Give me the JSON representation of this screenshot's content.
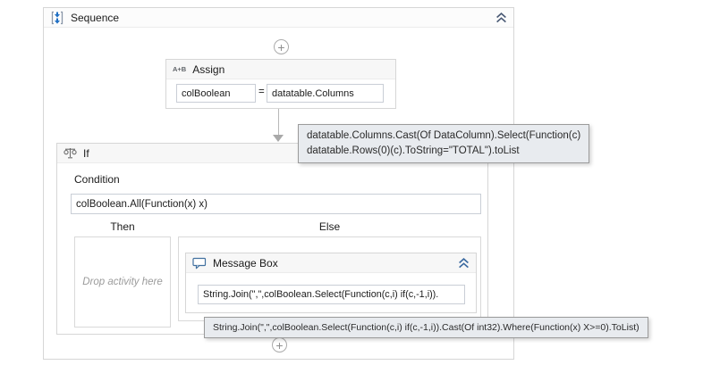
{
  "colors": {
    "accent_blue": "#1f6fc4",
    "activity_border": "#d6d6d6",
    "header_background": "#f7f7f7",
    "tooltip_background": "#e8ebef"
  },
  "icons": {
    "plus": "+",
    "sequence_icon": "bracketed-double-down-arrows",
    "assign_icon_label": "A+B",
    "if_icon": "scales",
    "message_icon": "speech-bubble",
    "collapse_icon": "chevron-double-up"
  },
  "sequence": {
    "title": "Sequence"
  },
  "assign": {
    "title": "Assign",
    "icon_label": "A+B",
    "to_value": "colBoolean",
    "equals_sign": "=",
    "value": "datatable.Columns"
  },
  "assign_tooltip": {
    "line1": "datatable.Columns.Cast(Of DataColumn).Select(Function(c)",
    "line2": "datatable.Rows(0)(c).ToString=\"TOTAL\").toList"
  },
  "if_activity": {
    "title": "If",
    "condition_label": "Condition",
    "condition_value": "colBoolean.All(Function(x) x)",
    "then_label": "Then",
    "else_label": "Else",
    "drop_hint": "Drop activity here"
  },
  "message_box": {
    "title": "Message Box",
    "text_value": "String.Join(\",\",colBoolean.Select(Function(c,i) if(c,-1,i))."
  },
  "message_tooltip": {
    "text": "String.Join(\",\",colBoolean.Select(Function(c,i) if(c,-1,i)).Cast(Of int32).Where(Function(x) X>=0).ToList)"
  }
}
